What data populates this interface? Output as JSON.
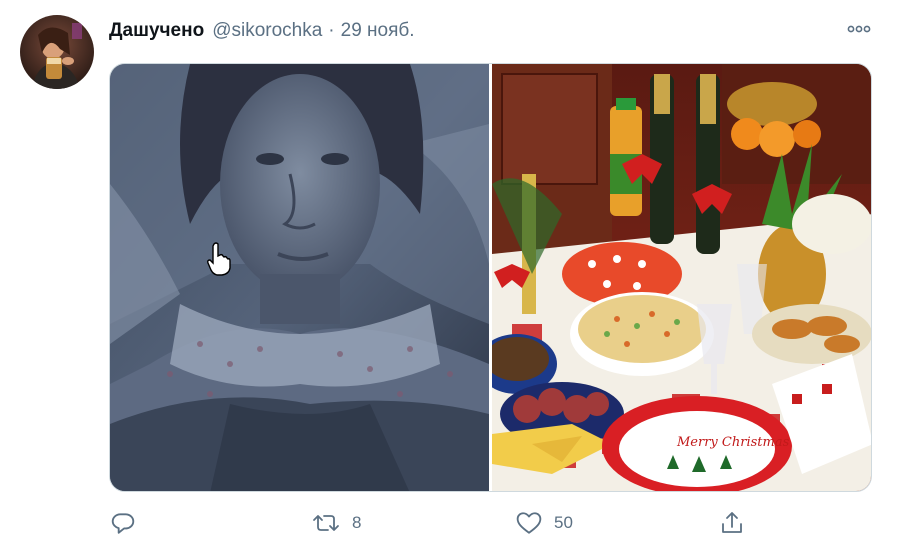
{
  "tweet": {
    "author_name": "Дашучено",
    "author_handle": "@sikorochka",
    "separator": "·",
    "timestamp": "29 нояб.",
    "reply_count": "",
    "retweet_count": "8",
    "like_count": "50"
  },
  "colors": {
    "text_primary": "#0f1419",
    "text_secondary": "#5b7083",
    "border": "#cfd9de",
    "tablecloth_red": "#c81d1d"
  },
  "icons": {
    "more": "more-dots-icon",
    "reply": "reply-icon",
    "retweet": "retweet-icon",
    "like": "heart-icon",
    "share": "share-icon",
    "cursor": "hand-pointer-icon"
  },
  "media": {
    "images": [
      "photo-girl-in-bed",
      "photo-festive-table"
    ],
    "christmas_plate_text": "Merry Christmas"
  }
}
